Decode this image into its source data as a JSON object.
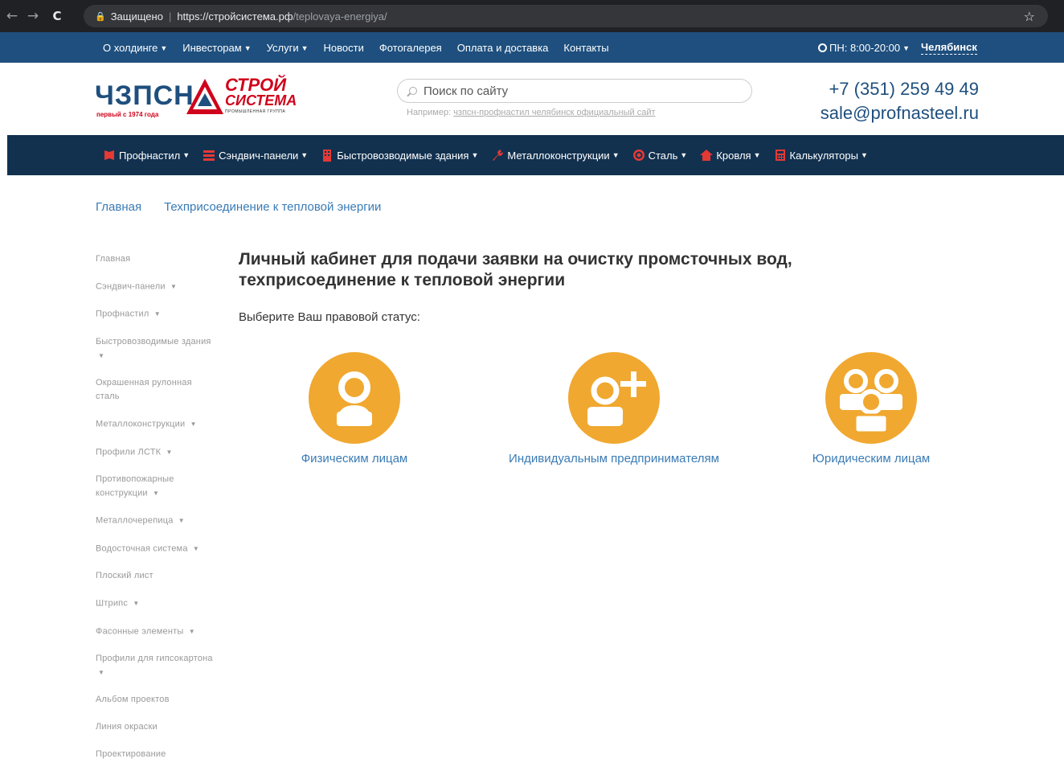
{
  "browser": {
    "secure_label": "Защищено",
    "url_host": "https://стройсистема.рф",
    "url_path": "/teplovaya-energiya/"
  },
  "topbar": {
    "items": [
      {
        "label": "О холдинге",
        "dropdown": true
      },
      {
        "label": "Инвесторам",
        "dropdown": true
      },
      {
        "label": "Услуги",
        "dropdown": true
      },
      {
        "label": "Новости",
        "dropdown": false
      },
      {
        "label": "Фотогалерея",
        "dropdown": false
      },
      {
        "label": "Оплата и доставка",
        "dropdown": false
      },
      {
        "label": "Контакты",
        "dropdown": false
      }
    ],
    "hours": "ПН: 8:00-20:00",
    "city": "Челябинск"
  },
  "header": {
    "logo_main": "ЧЗПСН",
    "logo_sub": "первый с 1974 года",
    "logo_stroy": "СТРОЙ",
    "logo_sistema": "СИСТЕМА",
    "logo_group": "ПРОМЫШЛЕННАЯ ГРУППА",
    "search_placeholder": "Поиск по сайту",
    "example_prefix": "Например:",
    "example_link": "чзпсн-профнастил челябинск официальный сайт",
    "phone": "+7 (351) 259 49 49",
    "email": "sale@profnasteel.ru"
  },
  "mainnav": {
    "items": [
      {
        "label": "Профнастил",
        "icon": "profnastil-icon",
        "color": "#e53935"
      },
      {
        "label": "Сэндвич-панели",
        "icon": "sandwich-icon",
        "color": "#e53935"
      },
      {
        "label": "Быстровозводимые здания",
        "icon": "building-icon",
        "color": "#e53935"
      },
      {
        "label": "Металлоконструкции",
        "icon": "wrench-icon",
        "color": "#e53935"
      },
      {
        "label": "Сталь",
        "icon": "target-icon",
        "color": "#e53935"
      },
      {
        "label": "Кровля",
        "icon": "house-icon",
        "color": "#e53935"
      },
      {
        "label": "Калькуляторы",
        "icon": "calculator-icon",
        "color": "#e53935"
      }
    ]
  },
  "breadcrumb": {
    "home": "Главная",
    "current": "Техприсоединение к тепловой энергии"
  },
  "sidebar": {
    "items": [
      {
        "label": "Главная",
        "dropdown": false
      },
      {
        "label": "Сэндвич-панели",
        "dropdown": true
      },
      {
        "label": "Профнастил",
        "dropdown": true
      },
      {
        "label": "Быстровозводимые здания",
        "dropdown": true
      },
      {
        "label": "Окрашенная рулонная сталь",
        "dropdown": false
      },
      {
        "label": "Металлоконструкции",
        "dropdown": true
      },
      {
        "label": "Профили ЛСТК",
        "dropdown": true
      },
      {
        "label": "Противопожарные конструкции",
        "dropdown": true
      },
      {
        "label": "Металлочерепица",
        "dropdown": true
      },
      {
        "label": "Водосточная система",
        "dropdown": true
      },
      {
        "label": "Плоский лист",
        "dropdown": false
      },
      {
        "label": "Штрипс",
        "dropdown": true
      },
      {
        "label": "Фасонные элементы",
        "dropdown": true
      },
      {
        "label": "Профили для гипсокартона",
        "dropdown": true
      },
      {
        "label": "Альбом проектов",
        "dropdown": false
      },
      {
        "label": "Линия окраски",
        "dropdown": false
      },
      {
        "label": "Проектирование",
        "dropdown": false
      }
    ]
  },
  "content": {
    "title": "Личный кабинет для подачи заявки на очистку промсточных вод, техприсоединение к тепловой энергии",
    "status_label": "Выберите Ваш правовой статус:",
    "options": [
      {
        "label": "Физическим лицам",
        "icon": "person-icon"
      },
      {
        "label": "Индивидуальным предпринимателям",
        "icon": "person-add-icon"
      },
      {
        "label": "Юридическим лицам",
        "icon": "group-icon"
      }
    ],
    "accent_color": "#f0a830"
  }
}
